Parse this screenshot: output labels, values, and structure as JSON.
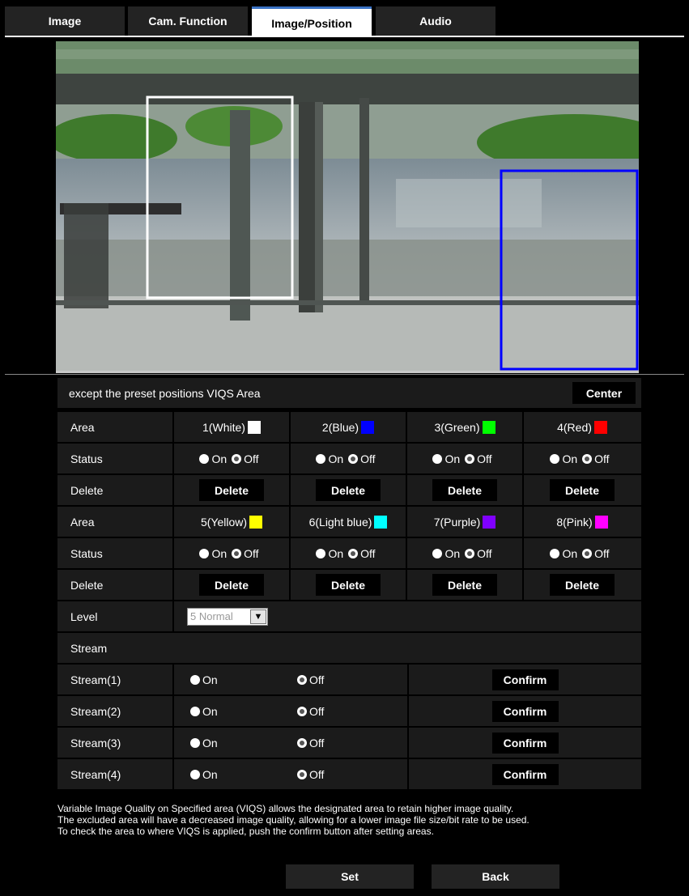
{
  "tabs": [
    {
      "label": "Image",
      "active": false
    },
    {
      "label": "Cam. Function",
      "active": false
    },
    {
      "label": "Image/Position",
      "active": true
    },
    {
      "label": "Audio",
      "active": false
    }
  ],
  "viqs": {
    "title": "except the preset positions  VIQS Area",
    "center_label": "Center",
    "area_label": "Area",
    "status_label": "Status",
    "delete_label": "Delete",
    "on_label": "On",
    "off_label": "Off",
    "areas_row1": [
      {
        "name": "1(White)",
        "color": "#ffffff",
        "status": "off"
      },
      {
        "name": "2(Blue)",
        "color": "#0000ff",
        "status": "off"
      },
      {
        "name": "3(Green)",
        "color": "#00ff00",
        "status": "off"
      },
      {
        "name": "4(Red)",
        "color": "#ff0000",
        "status": "off"
      }
    ],
    "areas_row2": [
      {
        "name": "5(Yellow)",
        "color": "#ffff00",
        "status": "off"
      },
      {
        "name": "6(Light blue)",
        "color": "#00ffff",
        "status": "off"
      },
      {
        "name": "7(Purple)",
        "color": "#8000ff",
        "status": "off"
      },
      {
        "name": "8(Pink)",
        "color": "#ff00ff",
        "status": "off"
      }
    ],
    "level_label": "Level",
    "level_value": "5 Normal",
    "stream_header": "Stream",
    "streams": [
      {
        "label": "Stream(1)",
        "value": "off"
      },
      {
        "label": "Stream(2)",
        "value": "off"
      },
      {
        "label": "Stream(3)",
        "value": "off"
      },
      {
        "label": "Stream(4)",
        "value": "off"
      }
    ],
    "confirm_label": "Confirm"
  },
  "note": "Variable Image Quality on Specified area (VIQS) allows the designated area to retain higher image quality.\nThe excluded area will have a decreased image quality, allowing for a lower image file size/bit rate to be used.\nTo check the area to where VIQS is applied, push the confirm button after setting areas.",
  "footer": {
    "set_label": "Set",
    "back_label": "Back"
  },
  "colors": {
    "active_tab_accent": "#3a72c4",
    "panel_bg": "#1b1b1b",
    "area1_frame": "#ffffff",
    "area2_frame": "#0000ff"
  }
}
